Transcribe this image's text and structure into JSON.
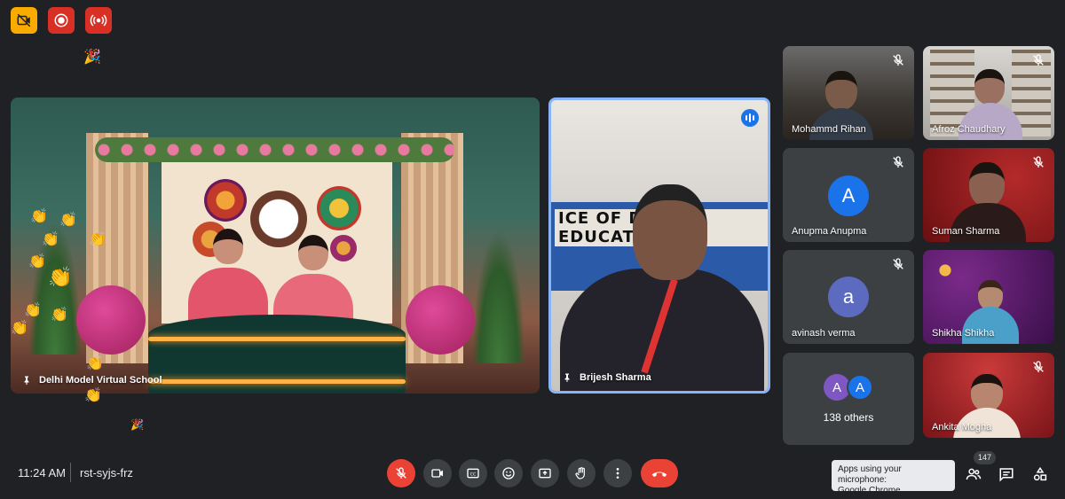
{
  "top_controls": {
    "items": [
      {
        "name": "no-video-icon",
        "color": "#f9ab00"
      },
      {
        "name": "recording-icon",
        "color": "#d93025"
      },
      {
        "name": "live-stream-icon",
        "color": "#d93025"
      }
    ]
  },
  "main_tiles": [
    {
      "name": "Delhi Model Virtual School",
      "pinned": true
    },
    {
      "name": "Brijesh Sharma",
      "pinned": true,
      "speaking": true,
      "poster_text": "ICE OF DYD    Z    EDUCATIO"
    }
  ],
  "grid_tiles": [
    {
      "name": "Mohammd Rihan",
      "muted": true,
      "video": true
    },
    {
      "name": "Afroz Chaudhary",
      "muted": true,
      "video": true
    },
    {
      "name": "Anupma Anupma",
      "muted": true,
      "video": false,
      "avatar": "A",
      "avatar_color": "#1a73e8"
    },
    {
      "name": "Suman Sharma",
      "muted": true,
      "video": true
    },
    {
      "name": "avinash verma",
      "muted": true,
      "video": false,
      "avatar": "a",
      "avatar_color": "#5c6bc0"
    },
    {
      "name": "Shikha Shikha",
      "muted": false,
      "video": true
    },
    {
      "name": "Ankita Mogha",
      "muted": true,
      "video": true
    }
  ],
  "others": {
    "count_label": "138 others",
    "avatar1": "A",
    "avatar2": "A",
    "avatar1_color": "#7e57c2",
    "avatar2_color": "#1a73e8"
  },
  "bottom_bar": {
    "time": "11:24 AM",
    "meeting_code": "rst-syjs-frz",
    "controls": [
      "mic-off-icon",
      "camera-icon",
      "captions-icon",
      "emoji-icon",
      "present-icon",
      "raise-hand-icon",
      "more-options-icon",
      "hang-up-icon"
    ],
    "tooltip_line1": "Apps using your microphone:",
    "tooltip_line2": "Google Chrome",
    "participants_count": "147",
    "right_controls": [
      "people-icon",
      "chat-icon",
      "activities-icon"
    ]
  },
  "colors": {
    "background": "#202124",
    "tile": "#3c4043",
    "accent": "#8ab4f8",
    "danger": "#ea4335"
  }
}
